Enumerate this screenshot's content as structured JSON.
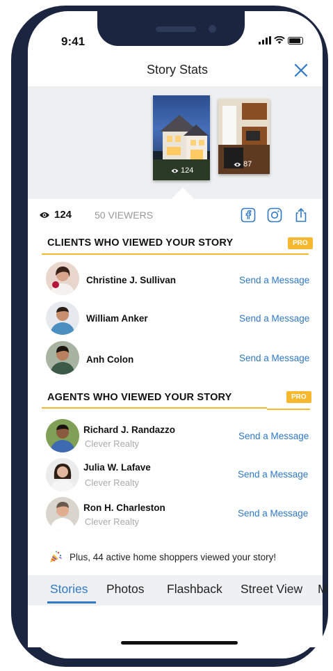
{
  "status": {
    "time": "9:41"
  },
  "header": {
    "title": "Story Stats"
  },
  "previews": [
    {
      "views": "124",
      "subject": "house-exterior"
    },
    {
      "views": "87",
      "subject": "kitchen-interior"
    }
  ],
  "stats": {
    "total_views": "124",
    "viewers": "50 VIEWERS"
  },
  "clients_section": {
    "title": "CLIENTS WHO VIEWED YOUR STORY",
    "badge": "PRO",
    "people": [
      {
        "name": "Christine J. Sullivan",
        "action": "Send a Message"
      },
      {
        "name": "William Anker",
        "action": "Send a Message"
      },
      {
        "name": "Anh  Colon",
        "action": "Send a Message"
      }
    ]
  },
  "agents_section": {
    "title": "AGENTS WHO VIEWED YOUR STORY",
    "badge": "PRO",
    "people": [
      {
        "name": "Richard J. Randazzo",
        "company": "Clever Realty",
        "action": "Send a Message"
      },
      {
        "name": "Julia W. Lafave",
        "company": "Clever Realty",
        "action": "Send a Message"
      },
      {
        "name": "Ron H. Charleston",
        "company": "Clever Realty",
        "action": "Send a Message"
      }
    ]
  },
  "shoppers_note": "Plus, 44 active home shoppers viewed your story!",
  "tabs": [
    {
      "label": "Stories"
    },
    {
      "label": "Photos"
    },
    {
      "label": "Flashback"
    },
    {
      "label": "Street View"
    },
    {
      "label": "M"
    }
  ],
  "colors": {
    "accent": "#2f78c4",
    "pro": "#f5b82e",
    "frame": "#1b2540"
  }
}
